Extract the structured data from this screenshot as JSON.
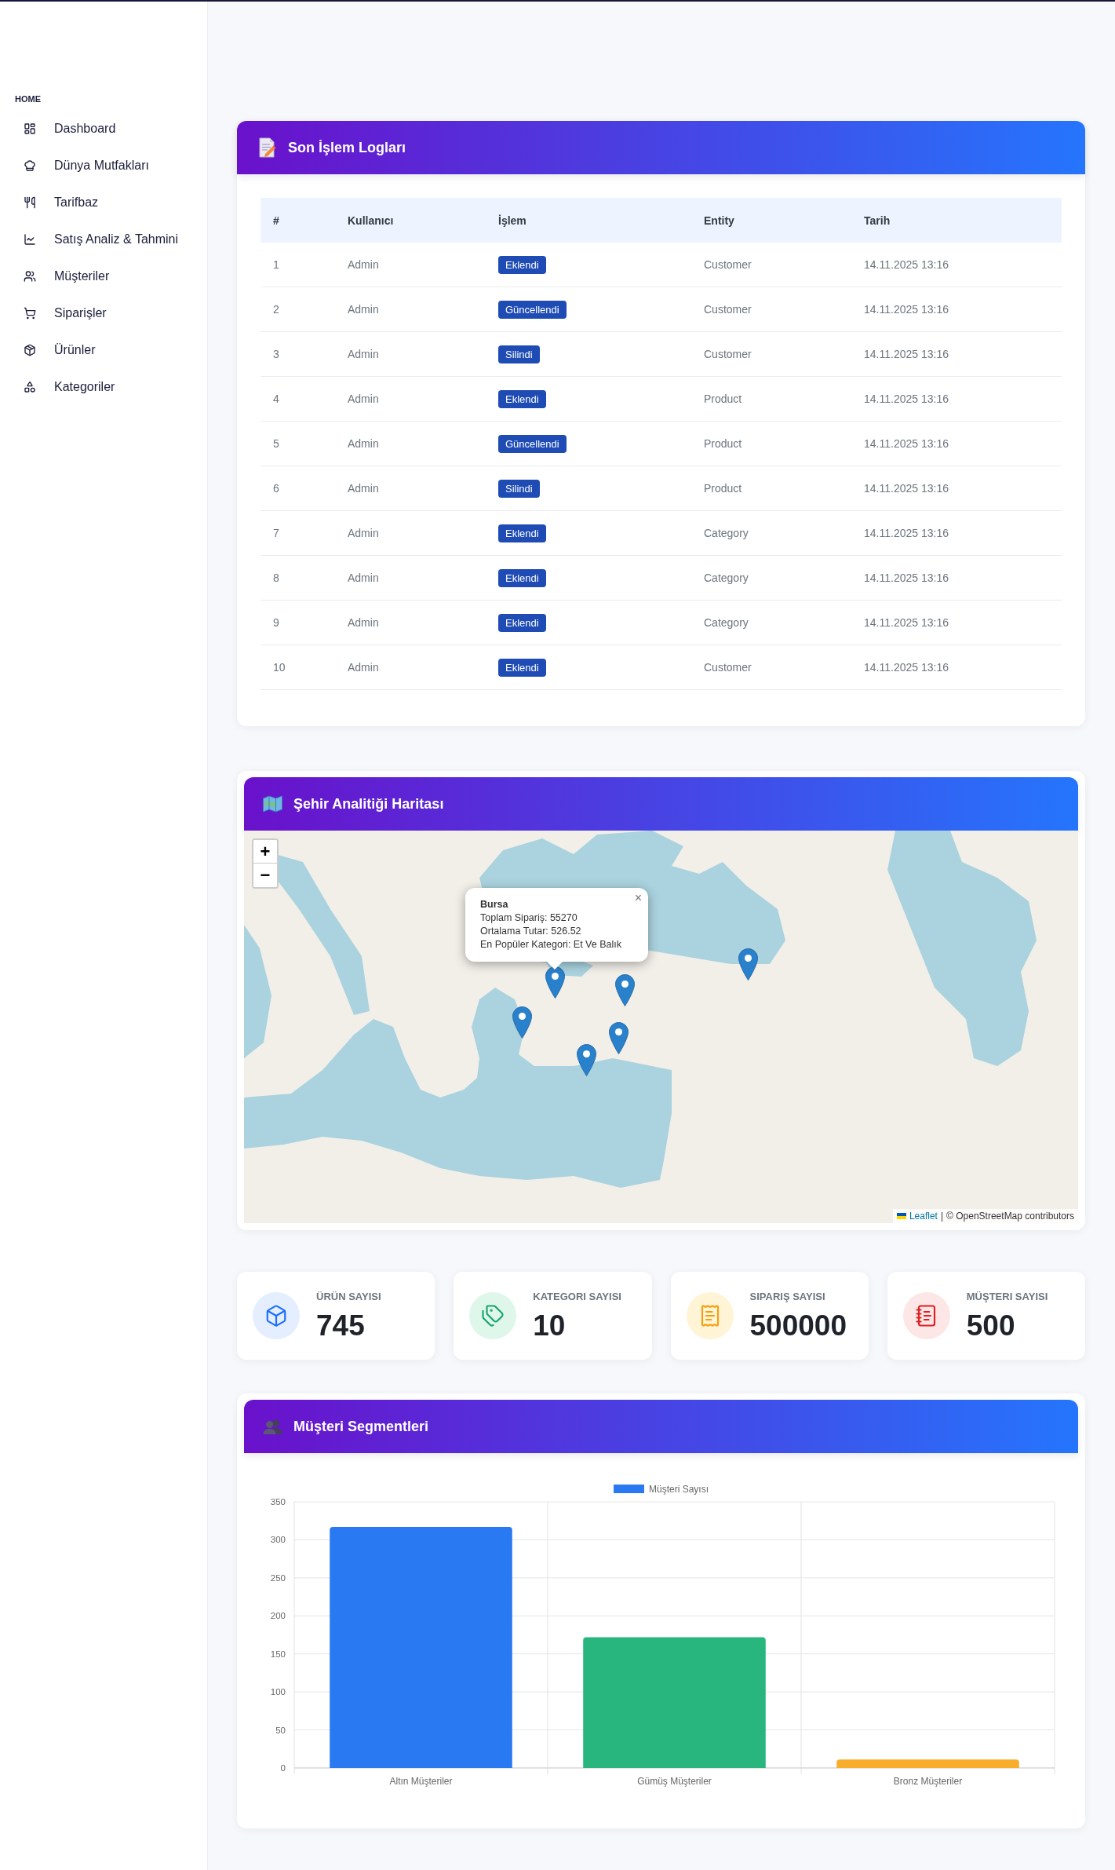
{
  "sidebar": {
    "section": "HOME",
    "items": [
      {
        "label": "Dashboard"
      },
      {
        "label": "Dünya Mutfakları"
      },
      {
        "label": "Tarifbaz"
      },
      {
        "label": "Satış Analiz & Tahmini"
      },
      {
        "label": "Müşteriler"
      },
      {
        "label": "Siparişler"
      },
      {
        "label": "Ürünler"
      },
      {
        "label": "Kategoriler"
      }
    ]
  },
  "log_card": {
    "title": "Son İşlem Logları",
    "columns": [
      "#",
      "Kullanıcı",
      "İşlem",
      "Entity",
      "Tarih"
    ],
    "rows": [
      {
        "no": "1",
        "user": "Admin",
        "action": "Eklendi",
        "entity": "Customer",
        "date": "14.11.2025 13:16"
      },
      {
        "no": "2",
        "user": "Admin",
        "action": "Güncellendi",
        "entity": "Customer",
        "date": "14.11.2025 13:16"
      },
      {
        "no": "3",
        "user": "Admin",
        "action": "Silindi",
        "entity": "Customer",
        "date": "14.11.2025 13:16"
      },
      {
        "no": "4",
        "user": "Admin",
        "action": "Eklendi",
        "entity": "Product",
        "date": "14.11.2025 13:16"
      },
      {
        "no": "5",
        "user": "Admin",
        "action": "Güncellendi",
        "entity": "Product",
        "date": "14.11.2025 13:16"
      },
      {
        "no": "6",
        "user": "Admin",
        "action": "Silindi",
        "entity": "Product",
        "date": "14.11.2025 13:16"
      },
      {
        "no": "7",
        "user": "Admin",
        "action": "Eklendi",
        "entity": "Category",
        "date": "14.11.2025 13:16"
      },
      {
        "no": "8",
        "user": "Admin",
        "action": "Eklendi",
        "entity": "Category",
        "date": "14.11.2025 13:16"
      },
      {
        "no": "9",
        "user": "Admin",
        "action": "Eklendi",
        "entity": "Category",
        "date": "14.11.2025 13:16"
      },
      {
        "no": "10",
        "user": "Admin",
        "action": "Eklendi",
        "entity": "Customer",
        "date": "14.11.2025 13:16"
      }
    ]
  },
  "map_card": {
    "title": "Şehir Analitiği Haritası",
    "zoom_in": "+",
    "zoom_out": "−",
    "popup": {
      "title": "Bursa",
      "lines": [
        "Toplam Sipariş: 55270",
        "Ortalama Tutar: 526.52",
        "En Popüler Kategori: Et Ve Balık"
      ],
      "close": "×"
    },
    "attribution": {
      "link": "Leaflet",
      "separator": "|",
      "text": "© OpenStreetMap contributors"
    }
  },
  "stats": [
    {
      "label": "ÜRÜN SAYISI",
      "value": "745"
    },
    {
      "label": "KATEGORI SAYISI",
      "value": "10"
    },
    {
      "label": "SIPARIŞ SAYISI",
      "value": "500000"
    },
    {
      "label": "MÜŞTERI SAYISI",
      "value": "500"
    }
  ],
  "segments_card": {
    "title": "Müşteri Segmentleri",
    "chart_data": {
      "type": "bar",
      "grid": true,
      "categories": [
        "Altın Müşteriler",
        "Gümüş Müşteriler",
        "Bronz Müşteriler"
      ],
      "series": [
        {
          "name": "Müşteri Sayısı",
          "color": "#2979f2",
          "colors": [
            "#2979f2",
            "#28b67e",
            "#f8ad2c"
          ],
          "values": [
            317,
            172,
            11
          ]
        }
      ],
      "ylim": [
        0,
        350
      ],
      "yticks": [
        0,
        50,
        100,
        150,
        200,
        250,
        300,
        350
      ]
    }
  }
}
